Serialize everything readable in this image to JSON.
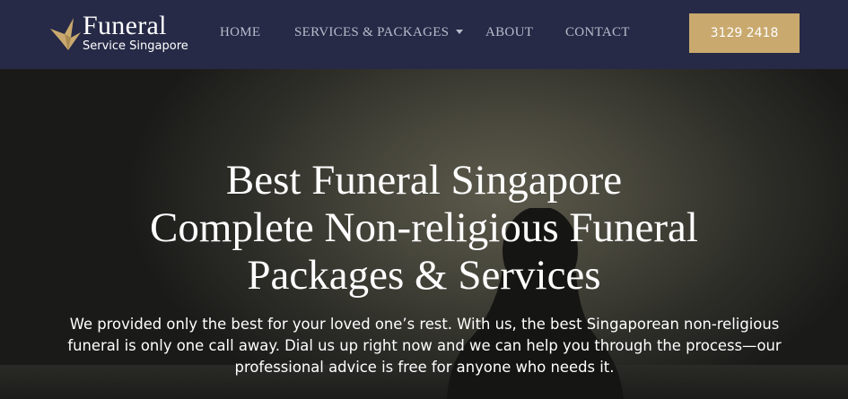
{
  "header": {
    "logo": {
      "title": "Funeral",
      "subtitle": "Service Singapore",
      "icon": "bird-logo-icon",
      "brand_color": "#c9a96e"
    },
    "nav": [
      {
        "label": "HOME"
      },
      {
        "label": "SERVICES & PACKAGES",
        "has_dropdown": true
      },
      {
        "label": "ABOUT"
      },
      {
        "label": "CONTACT"
      }
    ],
    "phone_button": {
      "label": "3129 2418",
      "color": "#c9a96e"
    },
    "background_color": "#262a47"
  },
  "hero": {
    "title_lines": [
      "Best Funeral Singapore",
      "Complete Non-religious Funeral",
      "Packages & Services"
    ],
    "description": "We provided only the best for your loved one’s rest. With us, the best Singaporean non-religious funeral is only one call away. Dial us up right now and we can help you through the process—our professional advice is free for anyone who needs it."
  }
}
